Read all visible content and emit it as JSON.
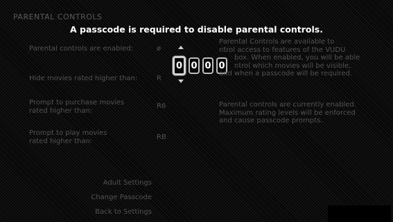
{
  "header": {
    "title": "PARENTAL CONTROLS"
  },
  "prompt": {
    "text": "A passcode is required to disable parental controls."
  },
  "settings": [
    {
      "label": "Parental controls are enabled:",
      "value": "ø"
    },
    {
      "label": "Hide movies rated higher than:",
      "value": "R"
    },
    {
      "label_line1": "Prompt to purchase movies",
      "label_line2": "rated higher than:",
      "value": "R6"
    },
    {
      "label_line1": "Prompt to play movies",
      "label_line2": "rated higher than:",
      "value": "RB"
    }
  ],
  "passcode": {
    "digits": [
      "0",
      "0",
      "0",
      "0"
    ],
    "active_index": 0
  },
  "description": {
    "para1": [
      "Parental Controls are available to",
      "ntrol access to features of the VUDU",
      "box. When enabled, you will be able",
      "ntrol which movies will be visible,",
      "and when a passcode will be required."
    ],
    "para2": [
      "Parental controls are currently enabled.",
      "Maximum rating levels will be enforced",
      "and cause passcode prompts."
    ]
  },
  "menu": {
    "adult_settings": "Adult Settings",
    "change_passcode": "Change Passcode",
    "back_to_settings": "Back to Settings"
  }
}
